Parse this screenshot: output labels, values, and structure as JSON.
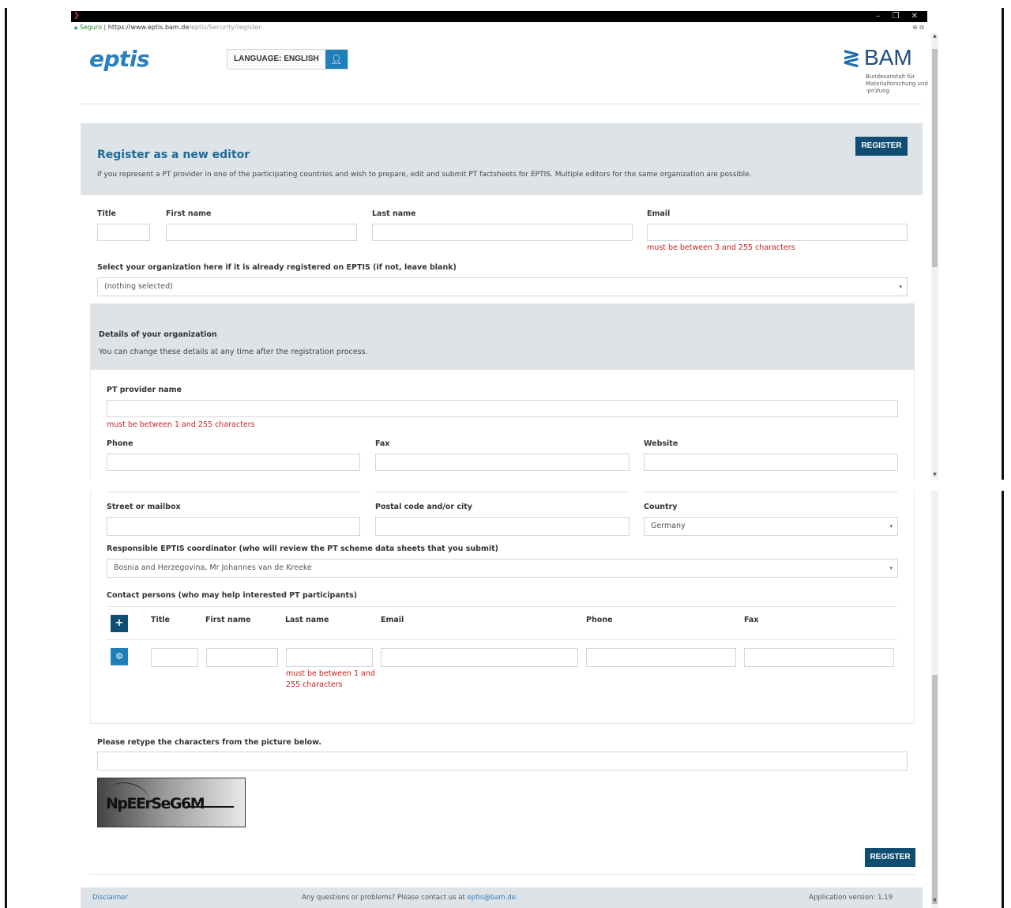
{
  "browser": {
    "secure_label": "Seguro",
    "url_host": "https://www.eptis.bam.de",
    "url_path": "/eptis/Security/register",
    "window_controls": "– ❐ ✕"
  },
  "header": {
    "logo": "eptis",
    "language_label": "LANGUAGE: ENGLISH",
    "bam_word": "BAM",
    "bam_subtitle": "Bundesanstalt für Materialforschung und -prüfung"
  },
  "banner": {
    "title": "Register as a new editor",
    "description": "if you represent a PT provider in one of the participating countries and wish to prepare, edit and submit PT factsheets for EPTIS. Multiple editors for the same organization are possible.",
    "register_label": "REGISTER"
  },
  "editor": {
    "title_label": "Title",
    "first_name_label": "First name",
    "last_name_label": "Last name",
    "email_label": "Email",
    "email_error": "must be between 3 and 255 characters",
    "org_select_label": "Select your organization here if it is already registered on EPTIS (if not, leave blank)",
    "org_select_value": "(nothing selected)"
  },
  "organization": {
    "panel_title": "Details of your organization",
    "panel_subtitle": "You can change these details at any time after the registration process.",
    "provider_name_label": "PT provider name",
    "provider_name_error": "must be between 1 and 255 characters",
    "phone_label": "Phone",
    "fax_label": "Fax",
    "website_label": "Website",
    "street_label": "Street or mailbox",
    "postal_label": "Postal code and/or city",
    "country_label": "Country",
    "country_value": "Germany",
    "coordinator_label": "Responsible EPTIS coordinator (who will review the PT scheme data sheets that you submit)",
    "coordinator_value": "Bosnia and Herzegovina, Mr Johannes van de Kreeke"
  },
  "contacts": {
    "section_label": "Contact persons (who may help interested PT participants)",
    "add_icon": "plus-icon",
    "row_icon": "gear-icon",
    "columns": [
      "Title",
      "First name",
      "Last name",
      "Email",
      "Phone",
      "Fax"
    ],
    "last_name_error": "must be between 1 and 255 characters"
  },
  "captcha": {
    "label": "Please retype the characters from the picture below.",
    "image_text": "NpEErSeG6M"
  },
  "bottom_register_label": "REGISTER",
  "footer": {
    "disclaimer": "Disclaimer",
    "contact_text": "Any questions or problems? Please contact us at",
    "contact_email": "eptis@bam.de.",
    "version": "Application version: 1.19"
  },
  "colors": {
    "accent_dark": "#0f4d73",
    "accent_blue": "#1f7fb8",
    "panel_bg": "#dde3e6",
    "error": "#cc2222"
  }
}
